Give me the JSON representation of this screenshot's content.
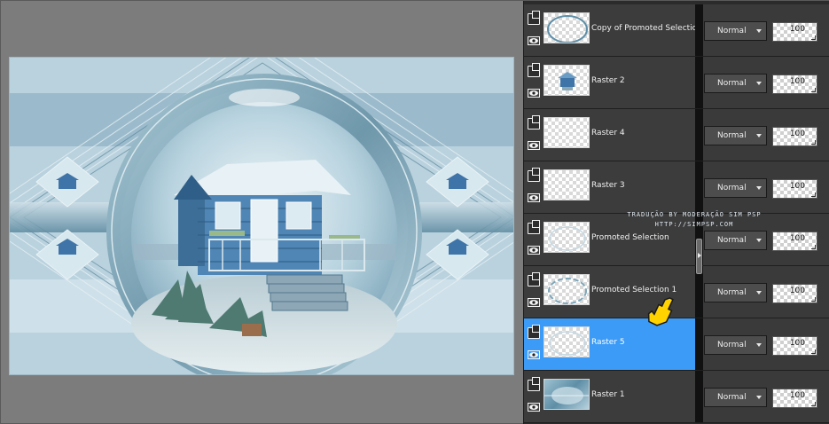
{
  "colors": {
    "panel_bg": "#2b2b2b",
    "row_bg": "#3c3c3c",
    "selected_row": "#3b9bf6",
    "workspace_bg": "#7c7c7c"
  },
  "watermark": {
    "line1": "TRADUÇÃO BY MODERAÇÃO SIM PSP",
    "line2": "HTTP://SIMPSP.COM"
  },
  "layers": [
    {
      "name": "Copy of Promoted Selection",
      "blend": "Normal",
      "opacity": "100",
      "selected": false,
      "thumb": "ring"
    },
    {
      "name": "Raster 2",
      "blend": "Normal",
      "opacity": "100",
      "selected": false,
      "thumb": "house"
    },
    {
      "name": "Raster 4",
      "blend": "Normal",
      "opacity": "100",
      "selected": false,
      "thumb": "empty"
    },
    {
      "name": "Raster 3",
      "blend": "Normal",
      "opacity": "100",
      "selected": false,
      "thumb": "empty"
    },
    {
      "name": "Promoted Selection",
      "blend": "Normal",
      "opacity": "100",
      "selected": false,
      "thumb": "faint"
    },
    {
      "name": "Promoted Selection 1",
      "blend": "Normal",
      "opacity": "100",
      "selected": false,
      "thumb": "faint-ring"
    },
    {
      "name": "Raster 5",
      "blend": "Normal",
      "opacity": "100",
      "selected": true,
      "thumb": "faint"
    },
    {
      "name": "Raster 1",
      "blend": "Normal",
      "opacity": "100",
      "selected": false,
      "thumb": "background"
    }
  ],
  "icons": {
    "visibility_toggle": "layer-visibility-icon",
    "eye": "eye-icon",
    "pointer": "pointing-hand-icon"
  }
}
